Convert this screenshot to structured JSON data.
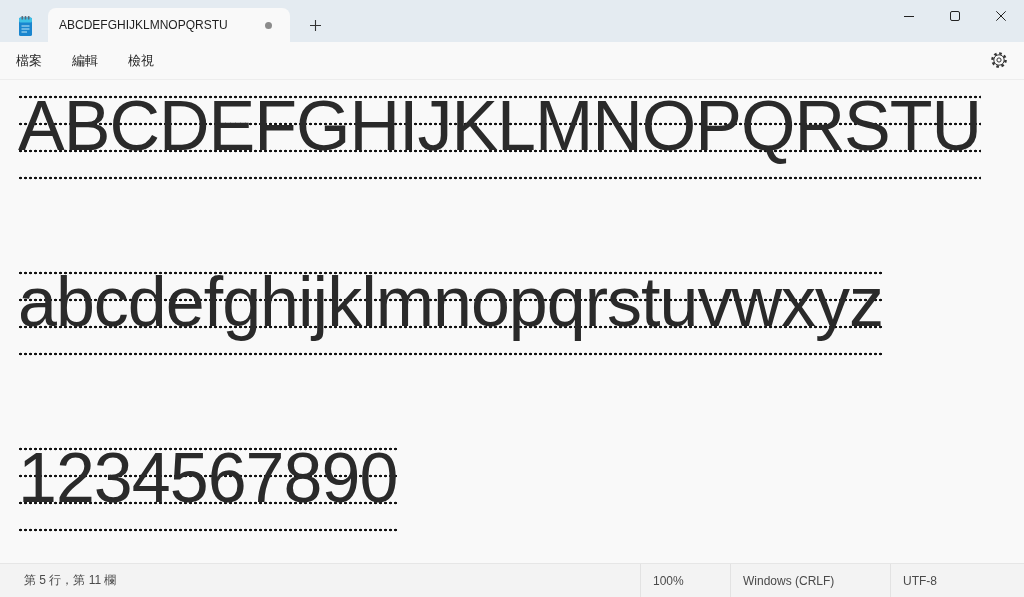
{
  "tabs": [
    {
      "title": "ABCDEFGHIJKLMNOPQRSTU",
      "selected": true,
      "unsaved": true
    }
  ],
  "menu": [
    "檔案",
    "編輯",
    "檢視"
  ],
  "document": {
    "lines": [
      "ABCDEFGHIJKLMNOPQRSTU",
      "abcdefghijklmnopqrstuvwxyz",
      "1234567890"
    ]
  },
  "status_bar": {
    "position": "第 5 行，第 11 欄",
    "zoom": "100%",
    "line_ending": "Windows (CRLF)",
    "encoding": "UTF-8"
  }
}
